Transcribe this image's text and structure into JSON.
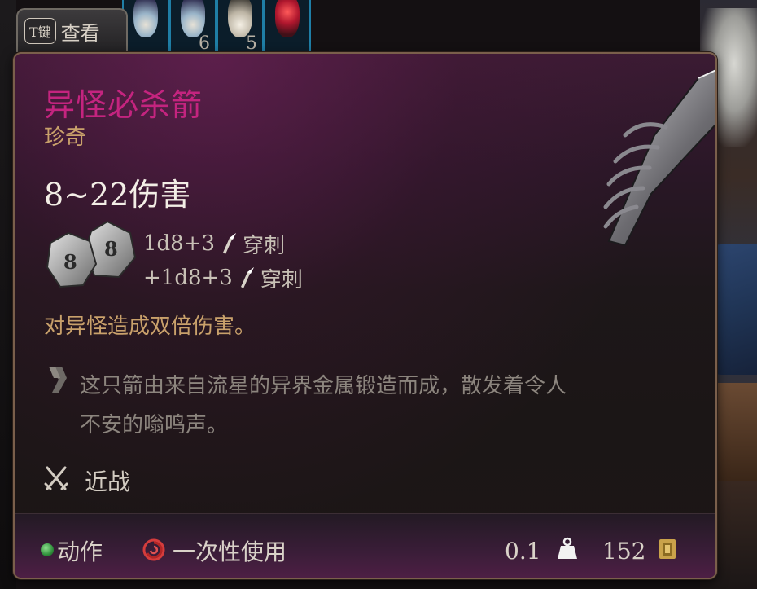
{
  "view_button": {
    "key": "T键",
    "label": "查看"
  },
  "hotbar": [
    {
      "icon": "blue-flask-icon",
      "count": ""
    },
    {
      "icon": "blue-flask-icon",
      "count": "6"
    },
    {
      "icon": "white-flask-icon",
      "count": "5"
    },
    {
      "icon": "red-gem-icon",
      "count": ""
    }
  ],
  "item": {
    "name": "异怪必杀箭",
    "rarity": "珍奇",
    "damage": "8~22伤害",
    "dice": [
      {
        "formula": "1d8+3",
        "type": "穿刺",
        "icon": "pierce-icon"
      },
      {
        "formula": "+1d8+3",
        "type": "穿刺",
        "icon": "pierce-icon"
      }
    ],
    "special": "对异怪造成双倍伤害。",
    "lore_line1": "这只箭由来自流星的异界金属锻造而成，散发着令人",
    "lore_line2": "不安的嗡鸣声。",
    "weapon_property": "近战",
    "footer": {
      "action": "动作",
      "consumable": "一次性使用",
      "weight": "0.1",
      "price": "152"
    }
  },
  "colors": {
    "title": "#c4247f",
    "rarity": "#c9a16b",
    "special": "#c9a16b",
    "lore": "#8c857e",
    "action_dot": "#2f8f3b"
  }
}
